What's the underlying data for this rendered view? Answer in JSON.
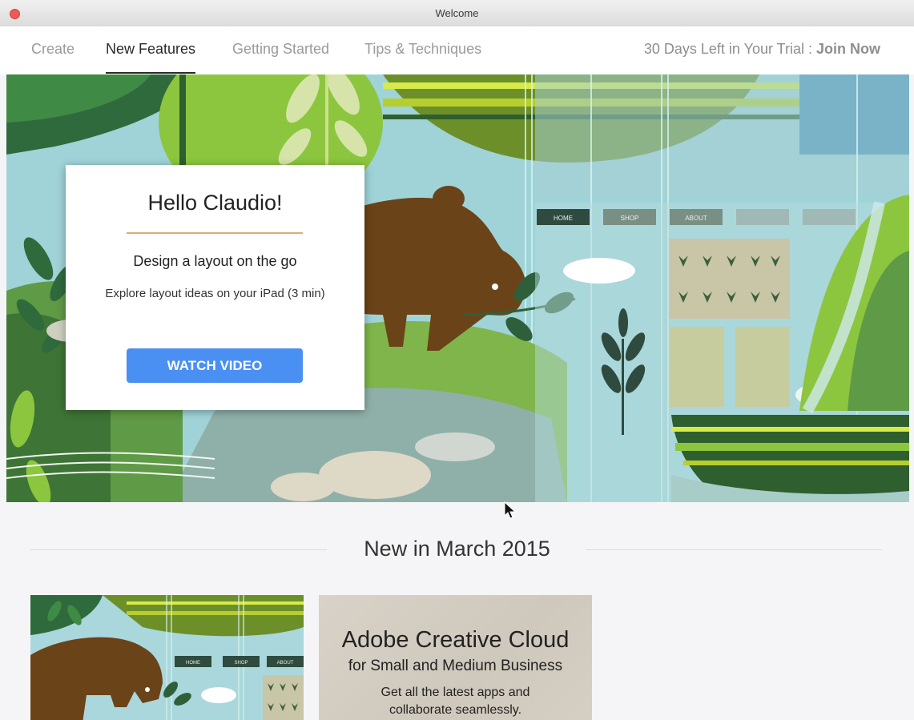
{
  "window": {
    "title": "Welcome"
  },
  "nav": {
    "tabs": [
      {
        "label": "Create",
        "active": false
      },
      {
        "label": "New Features",
        "active": true
      },
      {
        "label": "Getting Started",
        "active": false
      },
      {
        "label": "Tips & Techniques",
        "active": false
      }
    ],
    "trial_text": "30 Days Left in Your Trial : ",
    "join_label": "Join Now"
  },
  "hero": {
    "greeting": "Hello Claudio!",
    "subtitle": "Design a layout on the go",
    "description": "Explore layout ideas on your iPad (3 min)",
    "button_label": "WATCH VIDEO",
    "mock_nav": [
      "HOME",
      "SHOP",
      "ABOUT"
    ]
  },
  "section": {
    "title": "New in March 2015"
  },
  "cards": {
    "promo_title": "Adobe Creative Cloud",
    "promo_subtitle": "for Small and Medium Business",
    "promo_desc_line1": "Get all the latest apps and",
    "promo_desc_line2": "collaborate seamlessly."
  },
  "colors": {
    "accent_button": "#4a8ff2",
    "card_divider": "#d9b071",
    "bear": "#6b4318",
    "close_dot": "#ee5a55"
  }
}
